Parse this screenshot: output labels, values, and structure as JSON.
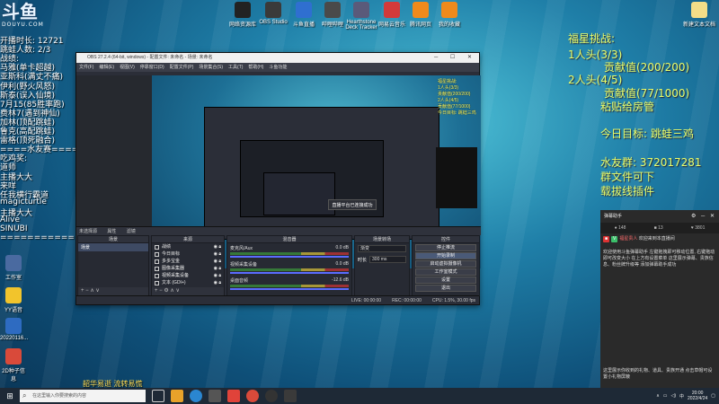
{
  "overlay_left": {
    "logo_text": "斗鱼",
    "logo_sub": "DOUYU.COM",
    "lines": [
      "开播时长: 12721",
      "跳蛙人数: 2/3",
      "战绩:",
      "马雅(单卡超越)",
      "亚斯科(满丈不痛)",
      "伊利(野火风怒)",
      "斯泰(误入仙境)",
      "7月15(85胜率跑)",
      "费林7(遇到神仙)",
      "加林(顶配跳蛙)",
      "鲁克(高配跳蛙)",
      "雷格(顶死融合)",
      "====水友赛====",
      "吃鸡奖:",
      "道师",
      "主播大大",
      "来咩",
      "任我横行霸道",
      "magicturtle",
      "主播大大",
      "Alive",
      "SINUBI",
      "================="
    ]
  },
  "desktop_icons_top": [
    {
      "label": "网络资源库",
      "color": "#222222"
    },
    {
      "label": "OBS Studio",
      "color": "#3a3a3a"
    },
    {
      "label": "斗鱼直播",
      "color": "#2f6fd0"
    },
    {
      "label": "哔哩哔哩",
      "color": "#4a4a4a"
    },
    {
      "label": "Hearthstone Deck Tracker",
      "color": "#5a5a7a"
    },
    {
      "label": "网易云音乐",
      "color": "#d33a3a"
    },
    {
      "label": "腾讯网页",
      "color": "#ef8a1c"
    },
    {
      "label": "我的收藏",
      "color": "#ef8a1c"
    }
  ],
  "desktop_icons_left": [
    {
      "label": "工作室",
      "color": "#4a6aa0"
    },
    {
      "label": "YY语音",
      "color": "#f2c42c"
    },
    {
      "label": "20220116...",
      "color": "#2e6bc1"
    },
    {
      "label": "2D种子信息",
      "color": "#d94a3a"
    }
  ],
  "desktop_icon_right": {
    "label": "新建文本文档",
    "color": "#f2dd88"
  },
  "obs": {
    "title": "OBS 27.2.4 (64-bit, windows) - 配置文件: 未命名 - 场景: 未命名",
    "menu": [
      "文件(F)",
      "编辑(E)",
      "视图(V)",
      "停靠窗口(D)",
      "配置文件(P)",
      "场景集合(S)",
      "工具(T)",
      "帮助(H)",
      "斗鱼功能"
    ],
    "tooltip": "直播平台已连接成功",
    "preview_text": [
      "福星挑战:",
      "1人头(3/3)",
      "贡献值(200/200)",
      "2人头(4/5)",
      "贡献值(77/1000)",
      "今日目标: 跳蛙三鸡"
    ],
    "dock_bar": [
      "未选择源",
      "属性",
      "滤镜"
    ],
    "docks": {
      "scenes": {
        "header": "场景",
        "items": [
          "场景"
        ]
      },
      "sources": {
        "header": "来源",
        "items": [
          "战绩",
          "今日目标",
          "多多宝金",
          "图像采集器",
          "视频采集设备",
          "文本 (GDI+)"
        ]
      },
      "mixer": {
        "header": "混音器",
        "channels": [
          {
            "name": "麦克风/Aux",
            "level": "0.0 dB"
          },
          {
            "name": "视频采集设备",
            "level": "0.0 dB"
          },
          {
            "name": "桌面音频",
            "level": "-12.6 dB"
          }
        ]
      },
      "transitions": {
        "header": "场景转场",
        "type": "渐变",
        "duration_label": "时长",
        "duration": "300 ms"
      },
      "controls": {
        "header": "控件",
        "buttons": [
          "停止推流",
          "开始录制",
          "启动虚拟摄像机",
          "工作室模式",
          "设置",
          "退出"
        ]
      }
    },
    "status": [
      "LIVE: 00:00:00",
      "REC: 00:00:00",
      "CPU: 1.5%, 30.00 fps"
    ]
  },
  "right_overlay": {
    "lines": [
      "福星挑战:",
      "1人头(3/3)",
      "贡献值(200/200)",
      "2人头(4/5)",
      "贡献值(77/1000)",
      "粘贴给房管",
      "今日目标: 跳蛙三鸡",
      "水友群: 372017281",
      "群文件可下",
      "载拔线插件"
    ]
  },
  "chat": {
    "title": "弹幕助手",
    "stats": [
      "148",
      "13",
      "3801"
    ],
    "messages": [
      {
        "badge": "福星贵人",
        "badge2": "",
        "text": "欢迎来到本直播间"
      },
      {
        "badge": "",
        "badge2": "",
        "text": "欢迎使用斗鱼弹幕助手 左键拖拽即可移动位置, 右键拖动即可改变大小 在上方有设置菜单 这里展示弹幕、贵族信息、粉丝牌升级等 添加弹幕助手成功"
      },
      {
        "badge": "",
        "badge2": "",
        "text": "这里展示你收到的礼物、道具、贵族开通 点击草帽可设置小礼物屏蔽"
      }
    ]
  },
  "taskbar": {
    "search_placeholder": "在这里输入你要搜索的内容",
    "time": "20:00",
    "date": "2022/4/24"
  },
  "bottom_text": "韶华易逝 流转易慌"
}
